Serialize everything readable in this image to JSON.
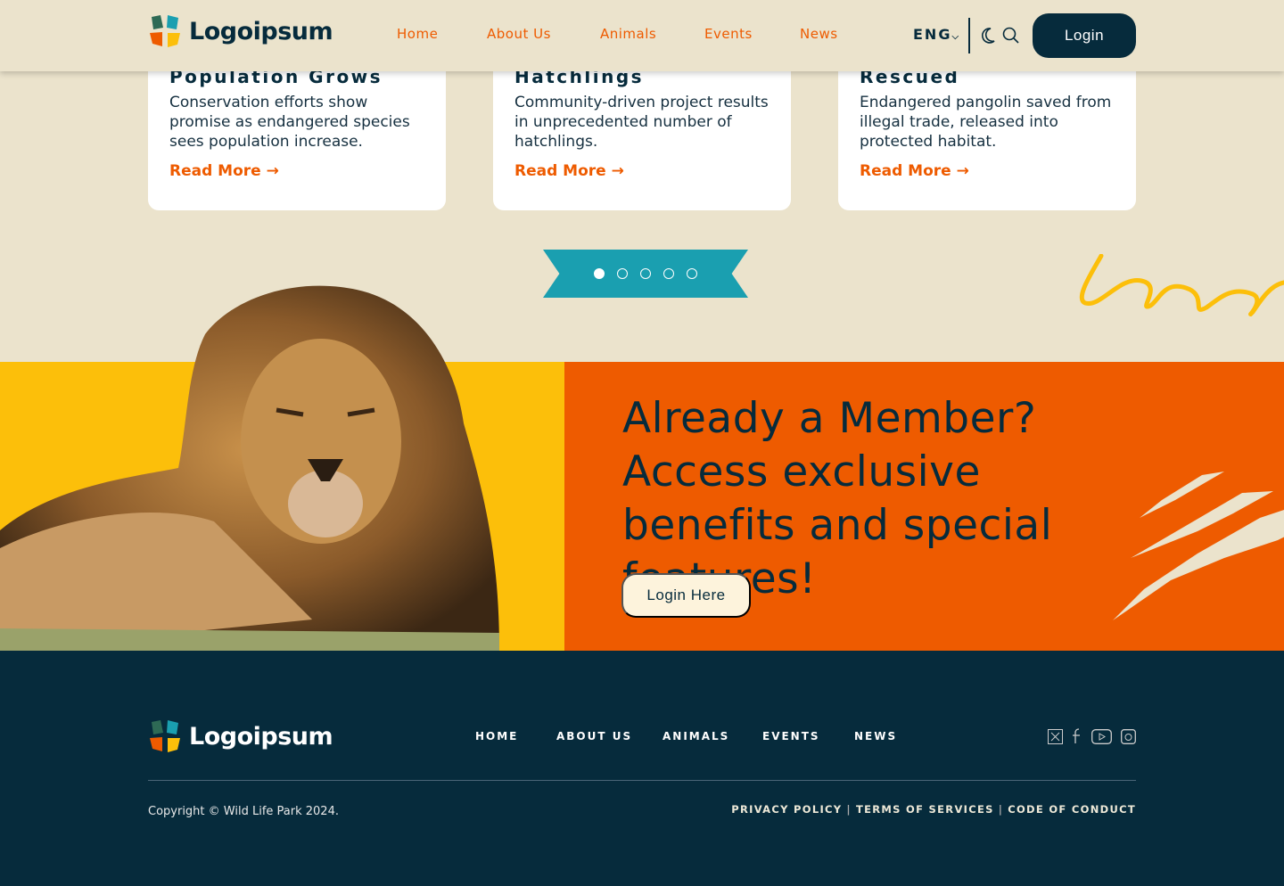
{
  "header": {
    "logo_text": "Logoipsum",
    "nav": [
      "Home",
      "About Us",
      "Animals",
      "Events",
      "News"
    ],
    "language": "ENG",
    "login_label": "Login"
  },
  "cards": [
    {
      "title": "Population Grows",
      "text": "Conservation efforts show promise as endangered species sees population increase.",
      "link": "Read More"
    },
    {
      "title": "Hatchlings",
      "text": "Community-driven project results in unprecedented number of hatchlings.",
      "link": "Read More"
    },
    {
      "title": "Rescued",
      "text": "Endangered pangolin saved from illegal trade, released into protected habitat.",
      "link": "Read More"
    }
  ],
  "carousel": {
    "pages": 5,
    "active": 1
  },
  "cta": {
    "headline": "Already a Member? Access exclusive benefits and special features!",
    "button": "Login Here"
  },
  "footer": {
    "logo_text": "Logoipsum",
    "nav": [
      "HOME",
      "ABOUT US",
      "ANIMALS",
      "EVENTS",
      "NEWS"
    ],
    "copyright": "Copyright © Wild Life Park 2024.",
    "legal": [
      "PRIVACY POLICY",
      "TERMS OF SERVICES",
      "CODE OF CONDUCT"
    ],
    "social": [
      "x-icon",
      "facebook-icon",
      "youtube-icon",
      "instagram-icon"
    ]
  },
  "colors": {
    "cream": "#ebe3cc",
    "navy": "#062b3c",
    "orange": "#ee5b00",
    "yellow": "#fcbf0a",
    "teal": "#1a9fb0"
  }
}
